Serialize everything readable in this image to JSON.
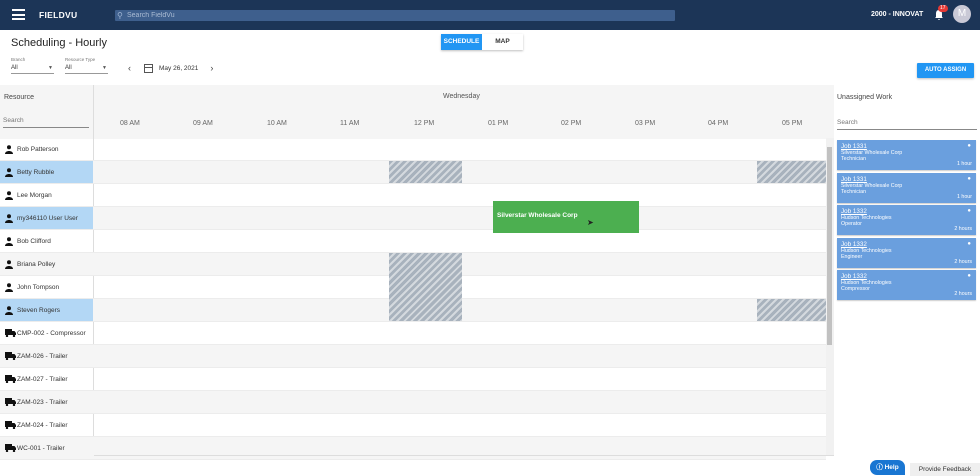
{
  "topbar": {
    "brand": "FIELDVU",
    "search_placeholder": "Search FieldVu",
    "company": "2000 - INNOVAT",
    "notification_count": "17",
    "avatar_initial": "M",
    "bar_color": "#1c3557"
  },
  "page": {
    "title": "Scheduling - Hourly",
    "view_schedule": "SCHEDULE",
    "view_map": "MAP",
    "auto_assign": "AUTO ASSIGN",
    "accent_color": "#2196f3"
  },
  "filters": {
    "branch_label": "Branch",
    "branch_value": "All",
    "resource_type_label": "Resource Type",
    "resource_type_value": "All",
    "date": "May 26, 2021"
  },
  "grid": {
    "resource_header": "Resource",
    "search_placeholder": "Search",
    "day": "Wednesday",
    "hours": [
      "08 AM",
      "09 AM",
      "10 AM",
      "11 AM",
      "12 PM",
      "01 PM",
      "02 PM",
      "03 PM",
      "04 PM",
      "05 PM"
    ],
    "resources": [
      {
        "name": "Rob Patterson",
        "icon": "person-icon"
      },
      {
        "name": "Betty Rubble",
        "icon": "person-icon"
      },
      {
        "name": "Lee Morgan",
        "icon": "person-icon"
      },
      {
        "name": "my346110 User User",
        "icon": "person-icon"
      },
      {
        "name": "Bob Clifford",
        "icon": "person-icon"
      },
      {
        "name": "Briana Polley",
        "icon": "person-icon"
      },
      {
        "name": "John Tompson",
        "icon": "person-icon"
      },
      {
        "name": "Steven Rogers",
        "icon": "person-icon"
      },
      {
        "name": "CMP-002 - Compressor",
        "icon": "truck-icon"
      },
      {
        "name": "ZAM-026 - Trailer",
        "icon": "truck-icon"
      },
      {
        "name": "ZAM-027 - Trailer",
        "icon": "truck-icon"
      },
      {
        "name": "ZAM-023 - Trailer",
        "icon": "truck-icon"
      },
      {
        "name": "ZAM-024 - Trailer",
        "icon": "truck-icon"
      },
      {
        "name": "WC-001 - Trailer",
        "icon": "truck-icon"
      }
    ],
    "event": {
      "label": "Silverstar Wholesale Corp",
      "color": "#4caf50"
    }
  },
  "unassigned": {
    "header": "Unassigned Work",
    "search_placeholder": "Search",
    "jobs": [
      {
        "title": "Job 1331",
        "customer": "Silverstar Wholesale Corp",
        "role": "Technician",
        "duration": "1 hour"
      },
      {
        "title": "Job 1331",
        "customer": "Silverstar Wholesale Corp",
        "role": "Technician",
        "duration": "1 hour"
      },
      {
        "title": "Job 1332",
        "customer": "Hudson Technologies",
        "role": "Operator",
        "duration": "2 hours"
      },
      {
        "title": "Job 1332",
        "customer": "Hudson Technologies",
        "role": "Engineer",
        "duration": "2 hours"
      },
      {
        "title": "Job 1332",
        "customer": "Hudson Technologies",
        "role": "Compressor",
        "duration": "2 hours"
      }
    ],
    "card_color": "#6a9fde"
  },
  "footer": {
    "help": "Help",
    "feedback": "Provide Feedback"
  }
}
